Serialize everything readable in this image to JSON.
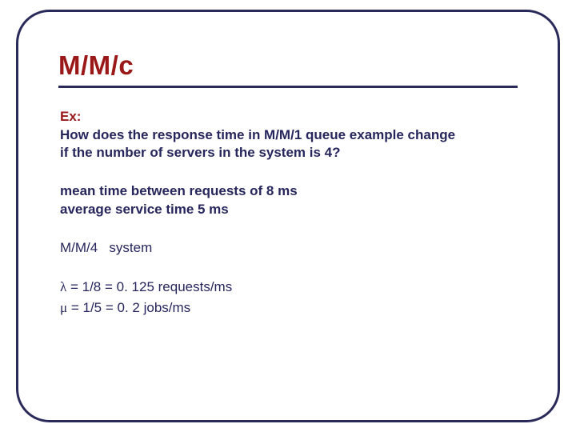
{
  "title": "M/M/c",
  "ex_label": "Ex:",
  "question_line1": "How does the response time in M/M/1 queue example change",
  "question_line2": "if the number of servers in the system is 4?",
  "param_line1": "mean time between requests of 8 ms",
  "param_line2": "average service time 5 ms",
  "system_label": "M/M/4   system",
  "lambda_symbol": "λ",
  "lambda_eq": " = 1/8 = 0. 125 requests/ms",
  "mu_symbol": "μ",
  "mu_eq": " = 1/5 = 0. 2 jobs/ms"
}
